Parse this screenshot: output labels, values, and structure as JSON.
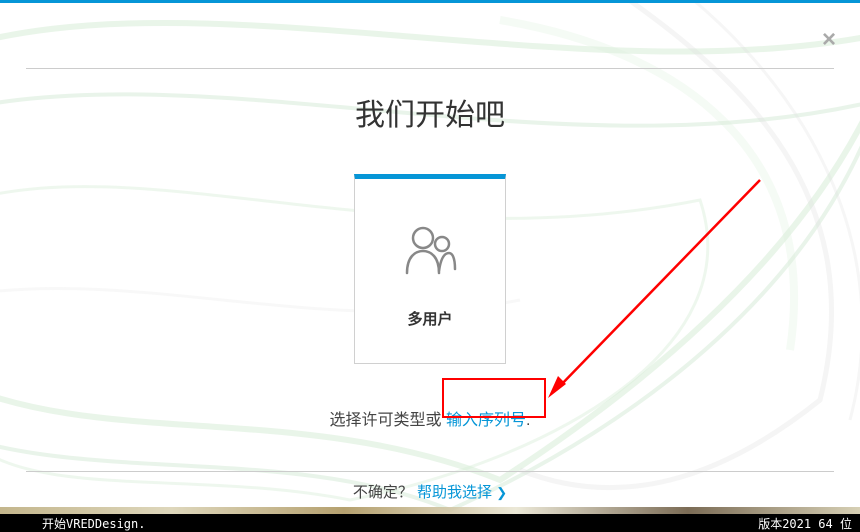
{
  "title": "我们开始吧",
  "card": {
    "label": "多用户"
  },
  "license": {
    "prefix": "选择许可类型或 ",
    "serial_link": "输入序列号",
    "suffix": "."
  },
  "footer": {
    "unsure": "不确定？",
    "help_link": "帮助我选择",
    "chevron": "❯"
  },
  "taskbar": {
    "left": "开始VREDDesign.",
    "right": "版本2021  64 位"
  }
}
